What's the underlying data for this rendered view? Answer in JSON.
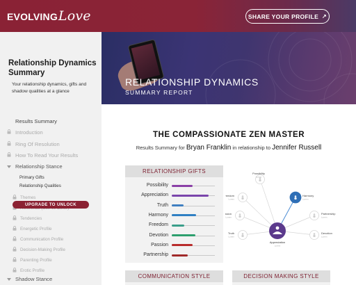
{
  "header": {
    "logo_text": "EVOLVING",
    "logo_script": "Love",
    "share_label": "SHARE YOUR PROFILE"
  },
  "sidebar": {
    "title": "Relationship Dynamics Summary",
    "subtitle": "Your relationship dynamics, gifts and shadow qualities at a glance",
    "items": [
      {
        "label": "Results Summary",
        "locked": false,
        "active": true
      },
      {
        "label": "Introduction",
        "locked": true
      },
      {
        "label": "Ring Of Resolution",
        "locked": true
      },
      {
        "label": "How To Read Your Results",
        "locked": true
      },
      {
        "label": "Relationship Stance",
        "section": true
      },
      {
        "label": "Primary Gifts",
        "sub": true
      },
      {
        "label": "Relationship Qualities",
        "sub": true
      },
      {
        "label": "Themes",
        "locked": true,
        "sub": true
      },
      {
        "label": "Reference (Self vs Other)",
        "locked": true,
        "sub": true
      },
      {
        "label": "Tendencies",
        "locked": true,
        "sub": true
      },
      {
        "label": "Energetic Profile",
        "locked": true,
        "sub": true
      },
      {
        "label": "Communication Profile",
        "locked": true,
        "sub": true
      },
      {
        "label": "Decision-Making Profile",
        "locked": true,
        "sub": true
      },
      {
        "label": "Parenting Profile",
        "locked": true,
        "sub": true
      },
      {
        "label": "Erotic Profile",
        "locked": true,
        "sub": true
      },
      {
        "label": "Shadow Stance",
        "section": true
      }
    ],
    "upgrade_label": "UPGRADE TO UNLOCK"
  },
  "hero": {
    "title": "RELATIONSHIP DYNAMICS",
    "subtitle": "SUMMARY REPORT"
  },
  "main": {
    "title": "THE COMPASSIONATE ZEN MASTER",
    "summary_prefix": "Results Summary for",
    "person1": "Bryan Franklin",
    "summary_mid": "in relationship to",
    "person2": "Jennifer Russell"
  },
  "gifts": {
    "heading": "RELATIONSHIP GIFTS",
    "rows": [
      {
        "label": "Possibility",
        "value": 0.48,
        "color": "#8a3fa6"
      },
      {
        "label": "Appreciation",
        "value": 0.86,
        "color": "#7a45ab"
      },
      {
        "label": "Truth",
        "value": 0.27,
        "color": "#3f7fc1"
      },
      {
        "label": "Harmony",
        "value": 0.56,
        "color": "#2f7fc3"
      },
      {
        "label": "Freedom",
        "value": 0.29,
        "color": "#3a9e8a"
      },
      {
        "label": "Devotion",
        "value": 0.55,
        "color": "#2d9f6e"
      },
      {
        "label": "Passion",
        "value": 0.49,
        "color": "#b82b2b"
      },
      {
        "label": "Partnership",
        "value": 0.37,
        "color": "#a02a2a"
      }
    ]
  },
  "diagram": {
    "center_label": "Appreciation",
    "center_sub": "Lorem",
    "highlight_label": "Harmony",
    "nodes": [
      {
        "label": "Possibility",
        "sub": "Lorem"
      },
      {
        "label": "Harmony",
        "sub": "Lorem"
      },
      {
        "label": "Partnership",
        "sub": "Lorem"
      },
      {
        "label": "Devotion",
        "sub": "Lorem"
      },
      {
        "label": "Truth",
        "sub": "Lorem"
      },
      {
        "label": "Passion",
        "sub": "Lorem"
      },
      {
        "label": "Freedom",
        "sub": "Lorem"
      }
    ]
  },
  "cards": {
    "communication": "COMMUNICATION STYLE",
    "decision": "DECISION MAKING STYLE"
  },
  "colors": {
    "brand": "#8a2235",
    "accent_blue": "#2f6fb6",
    "accent_purple": "#5b3a8c"
  }
}
